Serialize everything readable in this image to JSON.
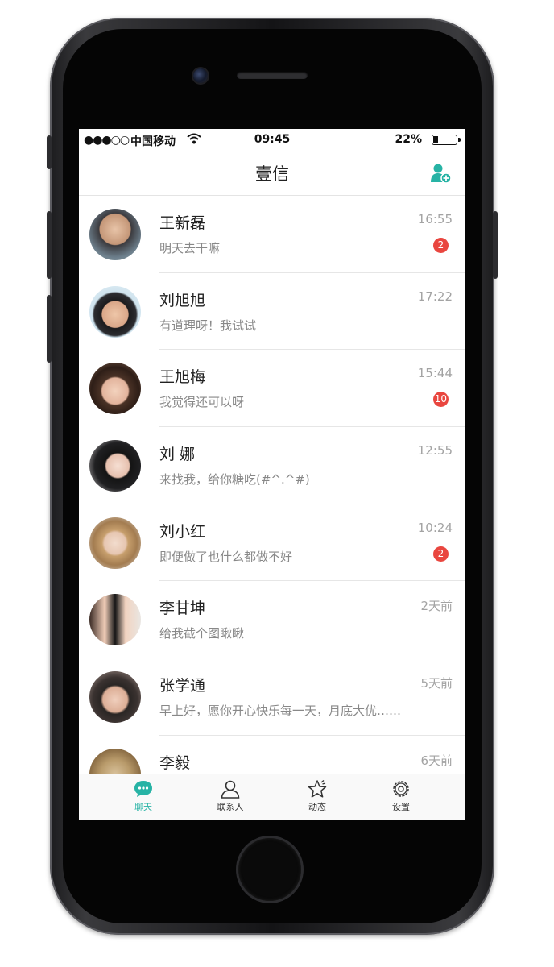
{
  "status_bar": {
    "signal": "●●●○○",
    "carrier": "中国移动",
    "time": "09:45",
    "battery": "22%",
    "battery_level": 0.22
  },
  "nav": {
    "title": "壹信",
    "add_icon": "add-contact-icon"
  },
  "colors": {
    "accent": "#27b3a5",
    "badge": "#e9463f"
  },
  "chats": [
    {
      "name": "王新磊",
      "message": "明天去干嘛",
      "time": "16:55",
      "badge": "2"
    },
    {
      "name": "刘旭旭",
      "message": "有道理呀！我试试",
      "time": "17:22",
      "badge": ""
    },
    {
      "name": "王旭梅",
      "message": "我觉得还可以呀",
      "time": "15:44",
      "badge": "10"
    },
    {
      "name": "刘 娜",
      "message": "来找我，给你糖吃(#^.^#)",
      "time": "12:55",
      "badge": ""
    },
    {
      "name": "刘小红",
      "message": "即便做了也什么都做不好",
      "time": "10:24",
      "badge": "2"
    },
    {
      "name": "李甘坤",
      "message": "给我截个图瞅瞅",
      "time": "2天前",
      "badge": ""
    },
    {
      "name": "张学通",
      "message": "早上好，愿你开心快乐每一天，月底大优……",
      "time": "5天前",
      "badge": ""
    },
    {
      "name": "李毅",
      "message": "",
      "time": "6天前",
      "badge": ""
    }
  ],
  "tabs": [
    {
      "label": "聊天",
      "icon": "chat-bubble-icon",
      "active": true
    },
    {
      "label": "联系人",
      "icon": "contacts-icon",
      "active": false
    },
    {
      "label": "动态",
      "icon": "star-icon",
      "active": false
    },
    {
      "label": "设置",
      "icon": "gear-icon",
      "active": false
    }
  ]
}
